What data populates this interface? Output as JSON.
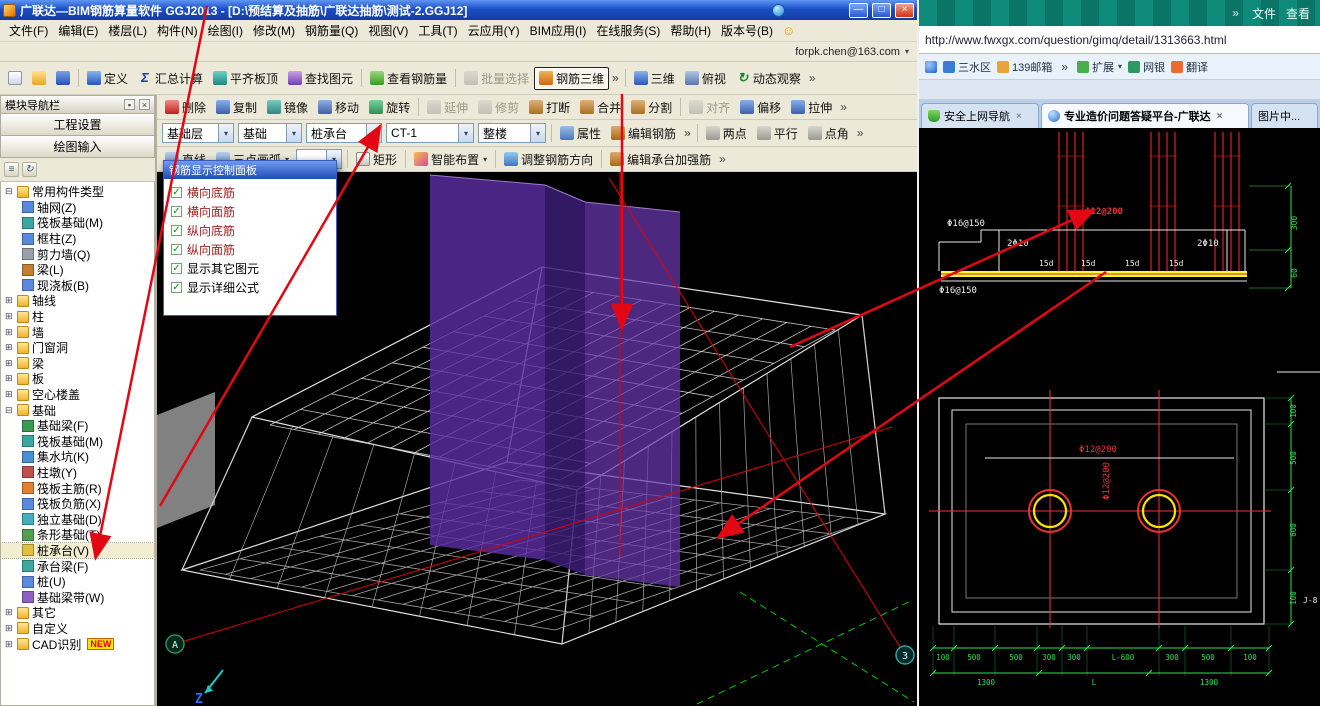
{
  "window": {
    "title": "广联达—BIM钢筋算量软件 GGJ2013 - [D:\\预结算及抽筋\\广联达抽筋\\测试-2.GGJ12]"
  },
  "icons": {
    "sigma": "Σ",
    "orbit": "↻",
    "check": "✓",
    "chevron": "»",
    "dropdown": "▾",
    "expand": "⊞",
    "collapse": "⊟",
    "minimize": "—",
    "restore": "□",
    "close": "×",
    "pin": "▪",
    "smiley": "☺"
  },
  "menus": [
    "文件(F)",
    "编辑(E)",
    "楼层(L)",
    "构件(N)",
    "绘图(I)",
    "修改(M)",
    "钢筋量(Q)",
    "视图(V)",
    "工具(T)",
    "云应用(Y)",
    "BIM应用(I)",
    "在线服务(S)",
    "帮助(H)",
    "版本号(B)"
  ],
  "account": {
    "email": "forpk.chen@163.com"
  },
  "tb1": {
    "items": [
      "定义",
      "汇总计算",
      "平齐板顶",
      "查找图元",
      "查看钢筋量",
      "批量选择",
      "钢筋三维",
      "三维",
      "俯视",
      "动态观察"
    ]
  },
  "tb2": {
    "items": [
      "删除",
      "复制",
      "镜像",
      "移动",
      "旋转",
      "延伸",
      "修剪",
      "打断",
      "合并",
      "分割",
      "对齐",
      "偏移",
      "拉伸"
    ]
  },
  "tb3": {
    "combos": [
      "基础层",
      "基础",
      "桩承台",
      "CT-1",
      "整楼"
    ],
    "buttons": [
      "属性",
      "编辑钢筋",
      "两点",
      "平行",
      "点角"
    ]
  },
  "tb4": {
    "items": [
      "直线",
      "三点画弧",
      "矩形",
      "智能布置",
      "调整钢筋方向",
      "编辑承台加强筋"
    ]
  },
  "sidebar": {
    "title": "模块导航栏",
    "sections": [
      "工程设置",
      "绘图输入"
    ],
    "new_badge": "NEW",
    "tree": [
      "常用构件类型",
      "轴网(Z)",
      "筏板基础(M)",
      "框柱(Z)",
      "剪力墙(Q)",
      "梁(L)",
      "现浇板(B)",
      "轴线",
      "柱",
      "墙",
      "门窗洞",
      "梁",
      "板",
      "空心楼盖",
      "基础",
      "基础梁(F)",
      "筏板基础(M)",
      "集水坑(K)",
      "柱墩(Y)",
      "筏板主筋(R)",
      "筏板负筋(X)",
      "独立基础(D)",
      "条形基础(T)",
      "桩承台(V)",
      "承台梁(F)",
      "桩(U)",
      "基础梁带(W)",
      "其它",
      "自定义",
      "CAD识别"
    ]
  },
  "panel": {
    "title": "钢筋显示控制面板",
    "items": [
      "横向底筋",
      "横向面筋",
      "纵向底筋",
      "纵向面筋",
      "显示其它图元",
      "显示详细公式"
    ]
  },
  "viewport": {
    "axis_a": "A",
    "axis_3": "3",
    "axis_z": "Z"
  },
  "browser": {
    "menus": [
      "文件",
      "查看"
    ],
    "url": "http://www.fwxgx.com/question/gimq/detail/1313663.html",
    "bookmarks": [
      "三水区",
      "139邮箱",
      "扩展",
      "网银",
      "翻译"
    ],
    "tabs": [
      "安全上网导航",
      "专业造价问题答疑平台-广联达",
      "图片中..."
    ]
  },
  "cad": {
    "section": {
      "top_steel": "Φ16@150",
      "stirrup_left": "2Φ10",
      "column_steel": "Φ12@200",
      "stirrup_right": "2Φ10",
      "hooks": [
        "15d",
        "15d",
        "15d",
        "15d"
      ],
      "bottom_steel": "Φ16@150",
      "dim_a": "300",
      "dim_b": "60"
    },
    "plan": {
      "mesh_h": "Φ12@200",
      "mesh_v": "Φ12@200",
      "tag": "J-8",
      "dims_bottom": [
        "100",
        "500",
        "500",
        "300",
        "300",
        "L-600",
        "300",
        "500",
        "100"
      ],
      "dims_total": [
        "1300",
        "L",
        "1300"
      ],
      "dims_right": [
        "100",
        "500",
        "600",
        "100"
      ]
    }
  }
}
